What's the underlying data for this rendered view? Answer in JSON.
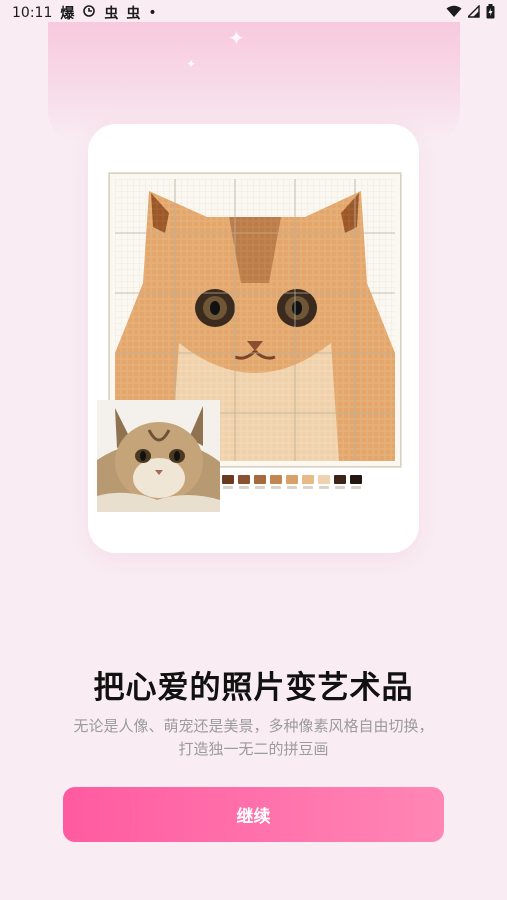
{
  "status_bar": {
    "time": "10:11",
    "notifications": [
      "爆",
      "虫",
      "虫"
    ],
    "dot": "•",
    "icons": [
      "sync-icon",
      "wifi-icon",
      "signal-icon",
      "battery-icon"
    ]
  },
  "onboarding": {
    "title": "把心爱的照片变艺术品",
    "subtitle": "无论是人像、萌宠还是美景，多种像素风格自由切换，打造独一无二的拼豆画",
    "continue_label": "继续"
  },
  "palette": {
    "accent": "#ff5ba0",
    "bead_colors": [
      "#6b3a22",
      "#8a5230",
      "#a86a3c",
      "#c48651",
      "#d9a06a",
      "#e8bb86",
      "#f0d3ae",
      "#3d2418",
      "#241612"
    ]
  }
}
